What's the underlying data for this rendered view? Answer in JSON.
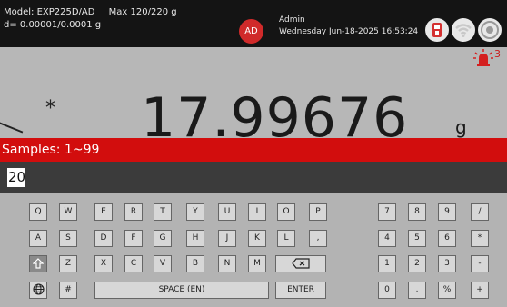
{
  "header": {
    "model": "Model: EXP225D/AD",
    "capacity": "Max 120/220 g",
    "division": "d= 0.00001/0.0001 g",
    "avatar_initials": "AD",
    "user_name": "Admin",
    "datetime": "Wednesday Jun-18-2025 16:53:24",
    "icons": [
      "usb-drive-icon",
      "wifi-icon",
      "level-indicator-icon"
    ],
    "avatar_color": "#d02a2a"
  },
  "display": {
    "alarm_count": "3",
    "stability_marker": "*",
    "weight": "17.99676",
    "unit": "g"
  },
  "samples": {
    "label": "Samples: 1~99",
    "bar_color": "#d20d0d"
  },
  "input": {
    "value": "20"
  },
  "keyboard": {
    "row1": [
      "Q",
      "W",
      "E",
      "R",
      "T",
      "Y",
      "U",
      "I",
      "O",
      "P"
    ],
    "row2": [
      "A",
      "S",
      "D",
      "F",
      "G",
      "H",
      "J",
      "K",
      "L",
      ","
    ],
    "row3": [
      "Z",
      "X",
      "C",
      "V",
      "B",
      "N",
      "M"
    ],
    "hash": "#",
    "space": "SPACE (EN)",
    "enter": "ENTER",
    "num_row1": [
      "7",
      "8",
      "9",
      "/"
    ],
    "num_row2": [
      "4",
      "5",
      "6",
      "*"
    ],
    "num_row3": [
      "1",
      "2",
      "3",
      "-"
    ],
    "num_row4": [
      "0",
      ".",
      "%",
      "+"
    ]
  }
}
